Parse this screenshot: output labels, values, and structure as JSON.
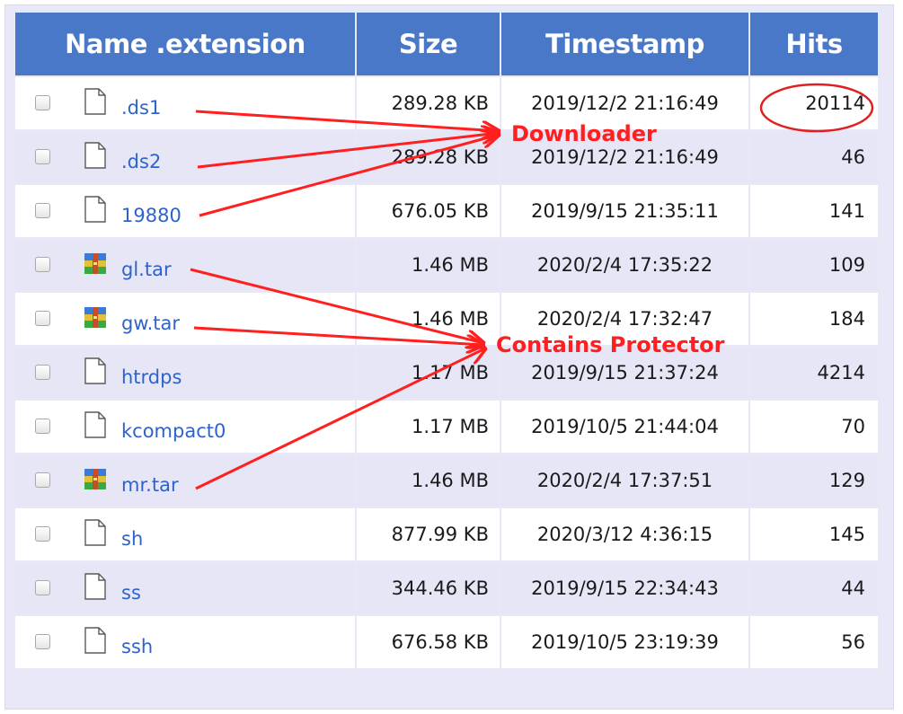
{
  "table": {
    "columns": [
      "Name .extension",
      "Size",
      "Timestamp",
      "Hits"
    ],
    "rows": [
      {
        "name": ".ds1",
        "size": "289.28 KB",
        "timestamp": "2019/12/2 21:16:49",
        "hits": "20114",
        "icon": "file-icon"
      },
      {
        "name": ".ds2",
        "size": "289.28 KB",
        "timestamp": "2019/12/2 21:16:49",
        "hits": "46",
        "icon": "file-icon"
      },
      {
        "name": "19880",
        "size": "676.05 KB",
        "timestamp": "2019/9/15 21:35:11",
        "hits": "141",
        "icon": "file-icon"
      },
      {
        "name": "gl.tar",
        "size": "1.46 MB",
        "timestamp": "2020/2/4 17:35:22",
        "hits": "109",
        "icon": "archive-icon"
      },
      {
        "name": "gw.tar",
        "size": "1.46 MB",
        "timestamp": "2020/2/4 17:32:47",
        "hits": "184",
        "icon": "archive-icon"
      },
      {
        "name": "htrdps",
        "size": "1.17 MB",
        "timestamp": "2019/9/15 21:37:24",
        "hits": "4214",
        "icon": "file-icon"
      },
      {
        "name": "kcompact0",
        "size": "1.17 MB",
        "timestamp": "2019/10/5 21:44:04",
        "hits": "70",
        "icon": "file-icon"
      },
      {
        "name": "mr.tar",
        "size": "1.46 MB",
        "timestamp": "2020/2/4 17:37:51",
        "hits": "129",
        "icon": "archive-icon"
      },
      {
        "name": "sh",
        "size": "877.99 KB",
        "timestamp": "2020/3/12 4:36:15",
        "hits": "145",
        "icon": "file-icon"
      },
      {
        "name": "ss",
        "size": "344.46 KB",
        "timestamp": "2019/9/15 22:34:43",
        "hits": "44",
        "icon": "file-icon"
      },
      {
        "name": "ssh",
        "size": "676.58 KB",
        "timestamp": "2019/10/5 23:19:39",
        "hits": "56",
        "icon": "file-icon"
      }
    ]
  },
  "annotations": {
    "downloader_label": "Downloader",
    "protector_label": "Contains Protector",
    "color": "#ff1f1f"
  },
  "colors": {
    "header_bg": "#4a78c8",
    "link": "#2f63c9",
    "row_alt": "#e6e6f6",
    "panel_bg": "#e8e8f8"
  }
}
